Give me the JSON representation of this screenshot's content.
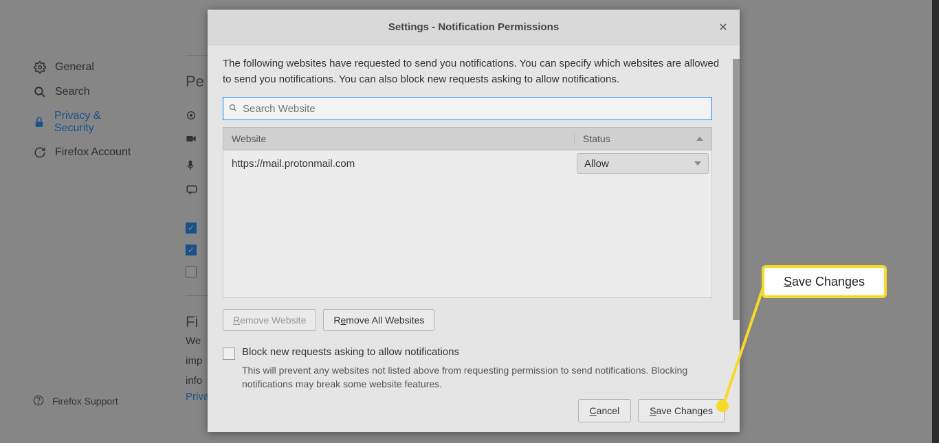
{
  "sidebar": {
    "items": [
      {
        "label": "General"
      },
      {
        "label": "Search"
      },
      {
        "label": "Privacy & Security"
      },
      {
        "label": "Firefox Account"
      }
    ],
    "support": "Firefox Support"
  },
  "bg": {
    "heading": "Pe",
    "subhead": "Fi",
    "text1": "We",
    "text2": "imp",
    "text3": "info",
    "link": "Privacy Notice"
  },
  "modal": {
    "title": "Settings - Notification Permissions",
    "desc": "The following websites have requested to send you notifications. You can specify which websites are allowed to send you notifications. You can also block new requests asking to allow notifications.",
    "search_placeholder": "Search Website",
    "table": {
      "th_website": "Website",
      "th_status": "Status",
      "rows": [
        {
          "url": "https://mail.protonmail.com",
          "status": "Allow"
        }
      ]
    },
    "remove_website": "Remove Website",
    "remove_all": "Remove All Websites",
    "block_label": "Block new requests asking to allow notifications",
    "block_sub": "This will prevent any websites not listed above from requesting permission to send notifications. Blocking notifications may break some website features.",
    "cancel": "Cancel",
    "save": "Save Changes"
  },
  "callout": "Save Changes"
}
